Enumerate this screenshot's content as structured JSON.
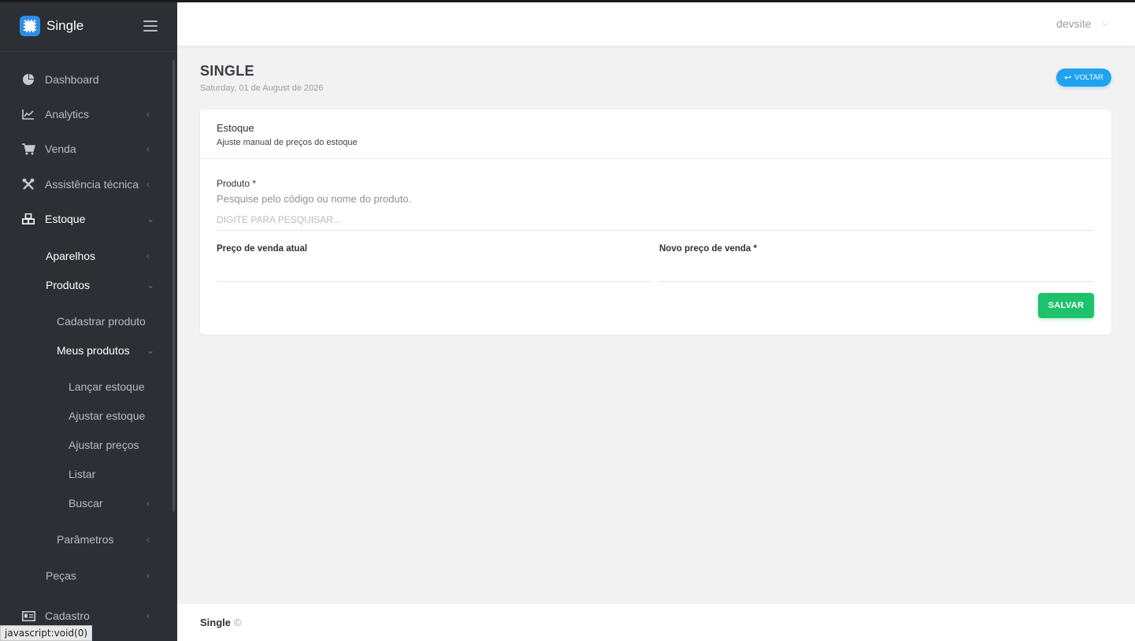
{
  "app": {
    "name": "Single"
  },
  "sidebar": {
    "items": [
      {
        "label": "Dashboard",
        "icon": "pie-chart-icon"
      },
      {
        "label": "Analytics",
        "icon": "line-chart-icon"
      },
      {
        "label": "Venda",
        "icon": "cart-icon"
      },
      {
        "label": "Assistência técnica",
        "icon": "tools-icon"
      },
      {
        "label": "Estoque",
        "icon": "boxes-icon"
      },
      {
        "label": "Aparelhos"
      },
      {
        "label": "Produtos"
      },
      {
        "label": "Cadastrar produto"
      },
      {
        "label": "Meus produtos"
      },
      {
        "label": "Lançar estoque"
      },
      {
        "label": "Ajustar estoque"
      },
      {
        "label": "Ajustar preços"
      },
      {
        "label": "Listar"
      },
      {
        "label": "Buscar"
      },
      {
        "label": "Parâmetros"
      },
      {
        "label": "Peças"
      },
      {
        "label": "Cadastro",
        "icon": "id-card-icon"
      }
    ]
  },
  "header": {
    "user": "devsite"
  },
  "page": {
    "title": "SINGLE",
    "date": "Saturday, 01 de August de 2026",
    "back_label": "VOLTAR"
  },
  "card": {
    "title": "Estoque",
    "subtitle": "Ajuste manual de preços do estoque",
    "product_label": "Produto *",
    "product_help": "Pesquise pelo código ou nome do produto.",
    "search_placeholder": "DIGITE PARA PESQUISAR...",
    "current_price_label": "Preço de venda atual",
    "new_price_label": "Novo preço de venda *",
    "save_label": "SALVAR"
  },
  "footer": {
    "brand": "Single",
    "copyright": "©"
  },
  "status_bar": {
    "text": "javascript:void(0)"
  },
  "colors": {
    "sidebar_bg": "#2c2f33",
    "accent_blue": "#1fa2f0",
    "save_green": "#1ec26a"
  }
}
